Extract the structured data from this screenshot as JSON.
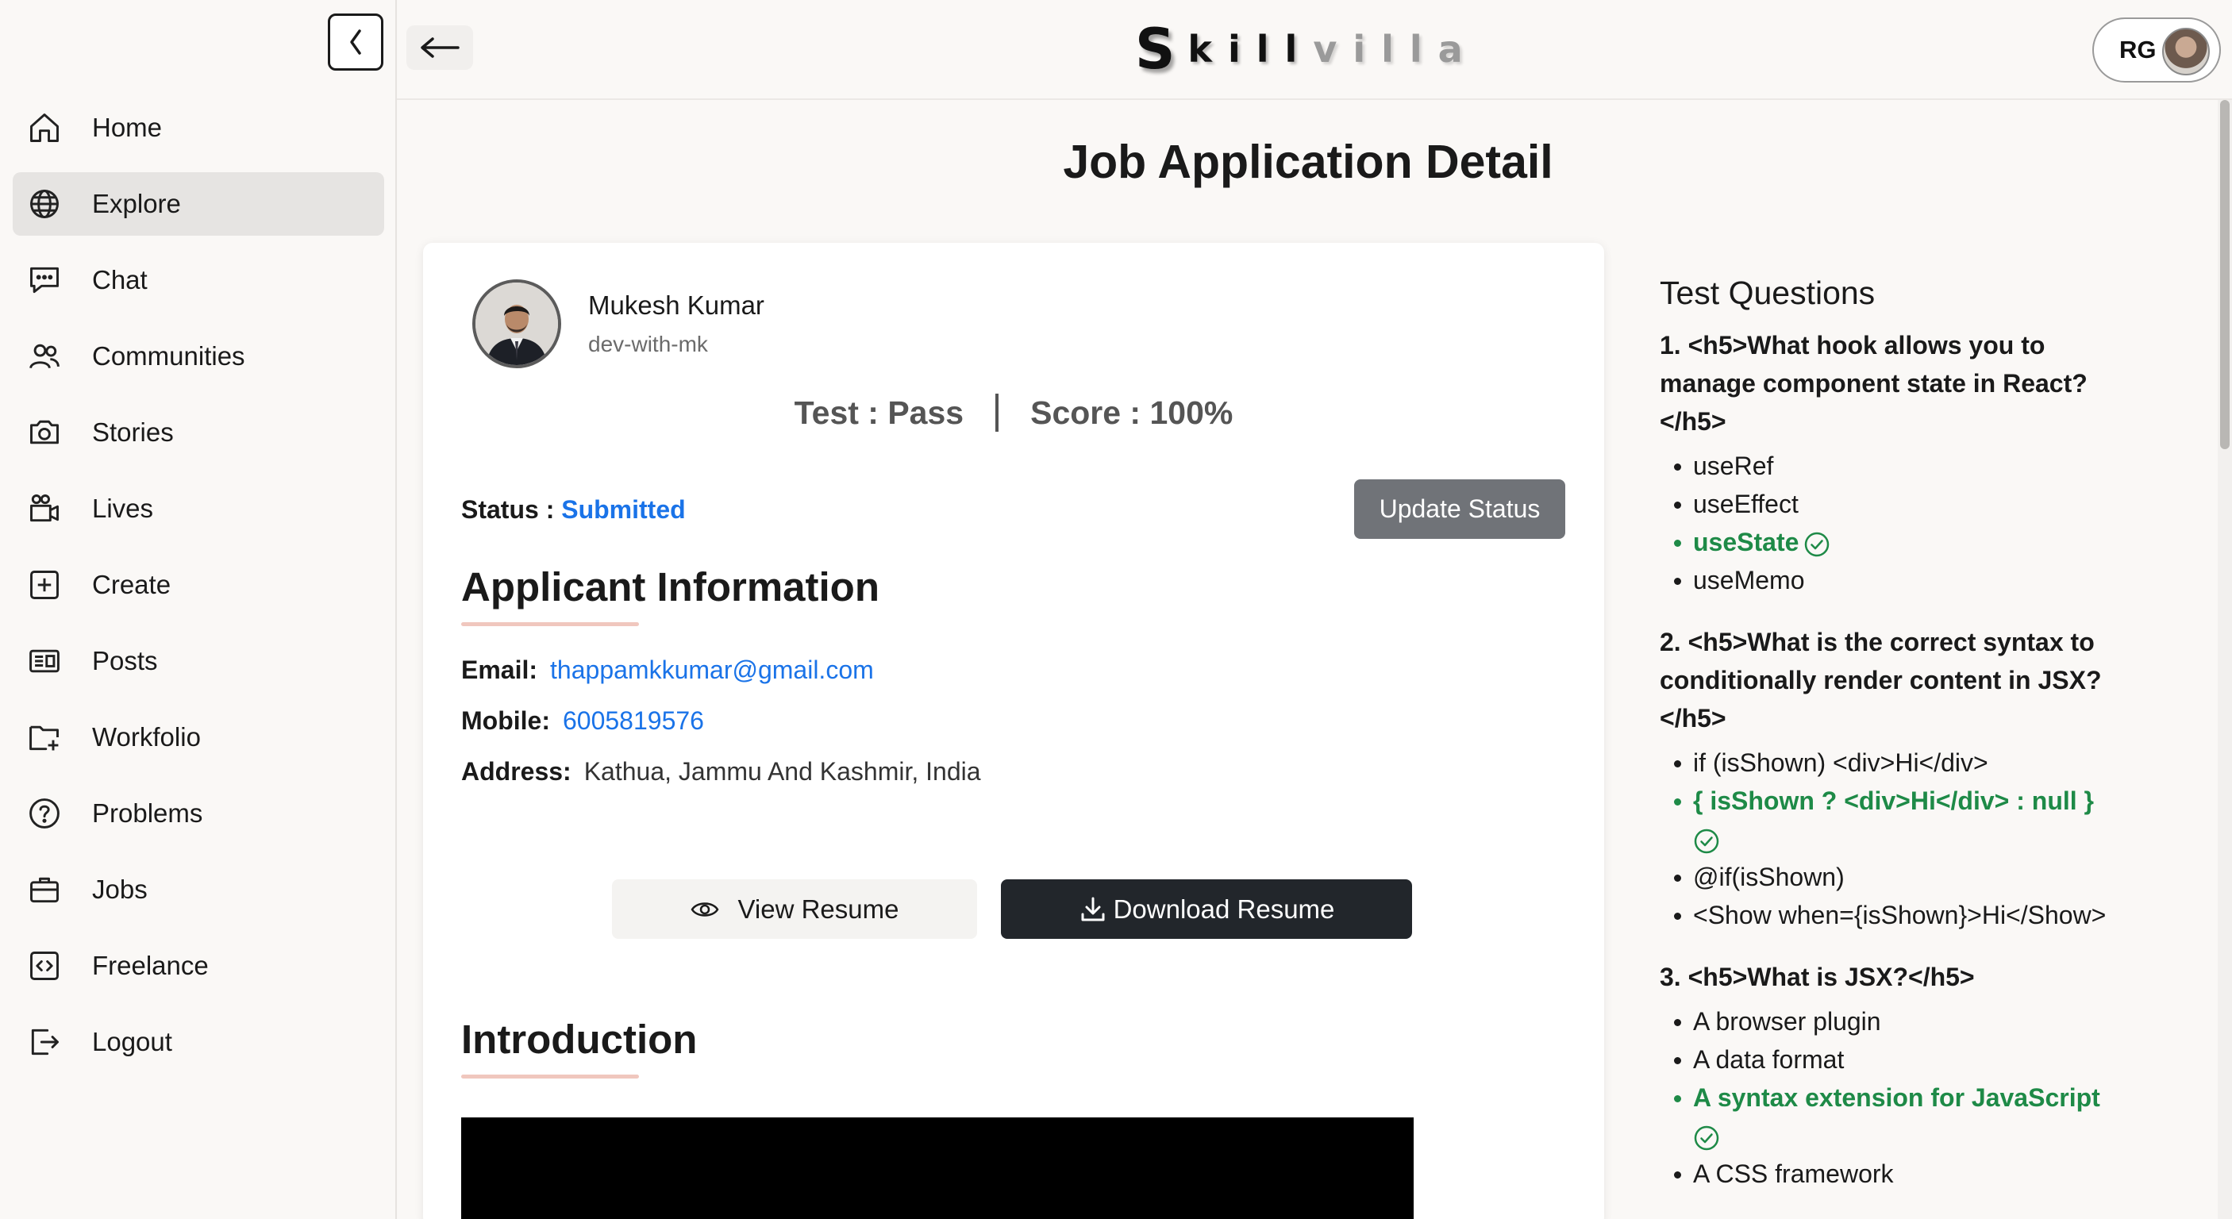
{
  "app": {
    "logo_letter": "S",
    "logo_dark": "kill",
    "logo_light": "villa"
  },
  "header": {
    "profile_initials": "RG"
  },
  "sidebar": {
    "items": [
      {
        "label": "Home",
        "icon": "home-icon",
        "active": false
      },
      {
        "label": "Explore",
        "icon": "globe-icon",
        "active": true
      },
      {
        "label": "Chat",
        "icon": "chat-icon",
        "active": false
      },
      {
        "label": "Communities",
        "icon": "users-icon",
        "active": false
      },
      {
        "label": "Stories",
        "icon": "camera-icon",
        "active": false
      },
      {
        "label": "Lives",
        "icon": "video-icon",
        "active": false
      },
      {
        "label": "Create",
        "icon": "plus-square-icon",
        "active": false
      },
      {
        "label": "Posts",
        "icon": "newspaper-icon",
        "active": false
      },
      {
        "label": "Workfolio",
        "icon": "folder-plus-icon",
        "active": false
      },
      {
        "label": "Problems",
        "icon": "question-circle-icon",
        "active": false
      },
      {
        "label": "Jobs",
        "icon": "briefcase-icon",
        "active": false
      },
      {
        "label": "Freelance",
        "icon": "code-square-icon",
        "active": false
      },
      {
        "label": "Logout",
        "icon": "logout-icon",
        "active": false
      }
    ]
  },
  "page": {
    "title": "Job Application Detail"
  },
  "applicant": {
    "name": "Mukesh Kumar",
    "handle": "dev-with-mk",
    "test_result": "Test : Pass",
    "score": "Score : 100%",
    "status_label": "Status :",
    "status_value": "Submitted",
    "update_status_label": "Update Status",
    "section_info": "Applicant Information",
    "email_label": "Email:",
    "email": "thappamkkumar@gmail.com",
    "mobile_label": "Mobile:",
    "mobile": "6005819576",
    "address_label": "Address:",
    "address": "Kathua, Jammu And Kashmir, India",
    "view_resume": "View Resume",
    "download_resume": "Download Resume",
    "section_intro": "Introduction"
  },
  "test_questions": {
    "title": "Test Questions",
    "questions": [
      {
        "text": "1. <h5>What hook allows you to manage component state in React?</h5>",
        "options": [
          "useRef",
          "useEffect",
          "useState",
          "useMemo"
        ],
        "correct_index": 2
      },
      {
        "text": "2. <h5>What is the correct syntax to conditionally render content in JSX?</h5>",
        "options": [
          "if (isShown) <div>Hi</div>",
          "{ isShown ? <div>Hi</div> : null }",
          "@if(isShown)",
          "<Show when={isShown}>Hi</Show>"
        ],
        "correct_index": 1
      },
      {
        "text": "3. <h5>What is JSX?</h5>",
        "options": [
          "A browser plugin",
          "A data format",
          "A syntax extension for JavaScript",
          "A CSS framework"
        ],
        "correct_index": 2
      }
    ]
  },
  "colors": {
    "accent_link": "#1a73e8",
    "correct": "#1e8a47",
    "update_btn": "#707378",
    "download_btn": "#22262b"
  }
}
